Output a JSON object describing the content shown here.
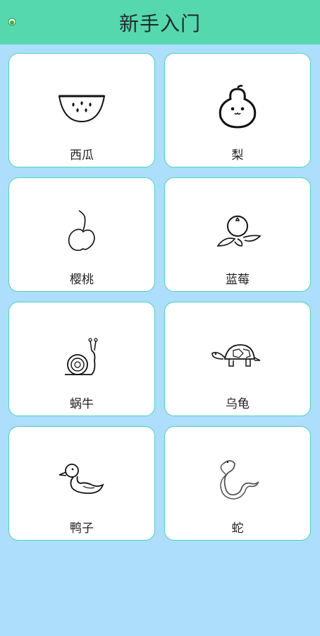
{
  "header": {
    "title": "新手入门",
    "back_icon": "back-icon"
  },
  "items": [
    {
      "label": "西瓜",
      "icon": "watermelon-icon"
    },
    {
      "label": "梨",
      "icon": "pear-icon"
    },
    {
      "label": "樱桃",
      "icon": "cherry-icon"
    },
    {
      "label": "蓝莓",
      "icon": "blueberry-icon"
    },
    {
      "label": "蜗牛",
      "icon": "snail-icon"
    },
    {
      "label": "乌龟",
      "icon": "turtle-icon"
    },
    {
      "label": "鸭子",
      "icon": "duck-icon"
    },
    {
      "label": "蛇",
      "icon": "snake-icon"
    }
  ],
  "colors": {
    "header_bg": "#56D8AE",
    "page_bg": "#ADDEFC",
    "card_border": "#4FD2B2"
  }
}
